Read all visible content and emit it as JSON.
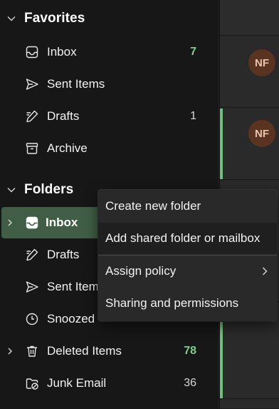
{
  "favorites": {
    "title": "Favorites",
    "items": [
      {
        "label": "Inbox",
        "icon": "inbox-icon",
        "count": "7",
        "unread": true
      },
      {
        "label": "Sent Items",
        "icon": "send-icon",
        "count": ""
      },
      {
        "label": "Drafts",
        "icon": "drafts-icon",
        "count": "1"
      },
      {
        "label": "Archive",
        "icon": "archive-icon",
        "count": ""
      }
    ]
  },
  "folders": {
    "title": "Folders",
    "items": [
      {
        "label": "Inbox",
        "icon": "inbox-icon",
        "count": "",
        "selected": true,
        "expandable": true
      },
      {
        "label": "Drafts",
        "icon": "drafts-icon",
        "count": ""
      },
      {
        "label": "Sent Items",
        "icon": "send-icon",
        "count": ""
      },
      {
        "label": "Snoozed",
        "icon": "clock-icon",
        "count": ""
      },
      {
        "label": "Deleted Items",
        "icon": "trash-icon",
        "count": "78",
        "unread": true,
        "expandable": true
      },
      {
        "label": "Junk Email",
        "icon": "junk-icon",
        "count": "36"
      }
    ]
  },
  "context_menu": {
    "items": [
      {
        "label": "Create new folder"
      },
      {
        "label": "Add shared folder or mailbox"
      },
      {
        "label": "Assign policy",
        "has_submenu": true
      },
      {
        "label": "Sharing and permissions"
      }
    ]
  },
  "message_list": {
    "avatars": [
      "NF",
      "NF"
    ]
  },
  "colors": {
    "accent_green": "#6fbf7d",
    "selected_bg": "#3f5e45",
    "avatar_bg": "#5a3420"
  }
}
